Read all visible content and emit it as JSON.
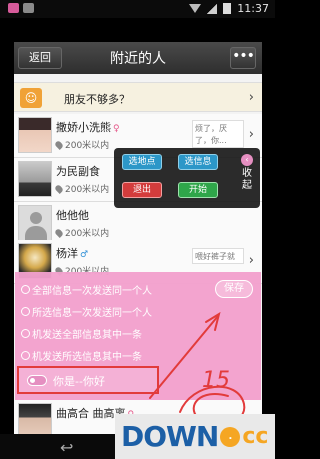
{
  "status_bar": {
    "time": "11:37"
  },
  "header": {
    "back_label": "返回",
    "title": "附近的人",
    "more_label": "•••"
  },
  "friends_banner": {
    "label": "朋友不够多？",
    "icon": "people-icon"
  },
  "people": [
    {
      "name": "撒娇小洗熊",
      "gender": "female",
      "distance": "200米以内",
      "signature": "烦了，厌了，你..."
    },
    {
      "name": "为民副食",
      "gender": "",
      "distance": "200米以内",
      "signature": ""
    },
    {
      "name": "他他他",
      "gender": "",
      "distance": "200米以内",
      "signature": ""
    },
    {
      "name": "杨洋",
      "gender": "male",
      "distance": "200米以内",
      "signature": "喂好裤子就问"
    },
    {
      "name": "曲高合 曲高离",
      "gender": "female",
      "distance": "",
      "signature": ""
    }
  ],
  "control_panel": {
    "select_location": "选地点",
    "select_message": "选信息",
    "exit": "退出",
    "start": "开始",
    "collapse": "收起"
  },
  "popup": {
    "save_label": "保存",
    "options": [
      "全部信息一次发送同一个人",
      "所选信息一次发送同一个人",
      "机发送全部信息其中一条",
      "机发送所选信息其中一条"
    ],
    "message_text": "你是--你好"
  },
  "annotation": {
    "number": "15"
  },
  "watermark": {
    "text_main": "DOWN",
    "text_ext": "cc"
  },
  "colors": {
    "popup": "#f2a0cd",
    "accent_red": "#e23b3b",
    "panel_blue": "#2c97c8"
  }
}
